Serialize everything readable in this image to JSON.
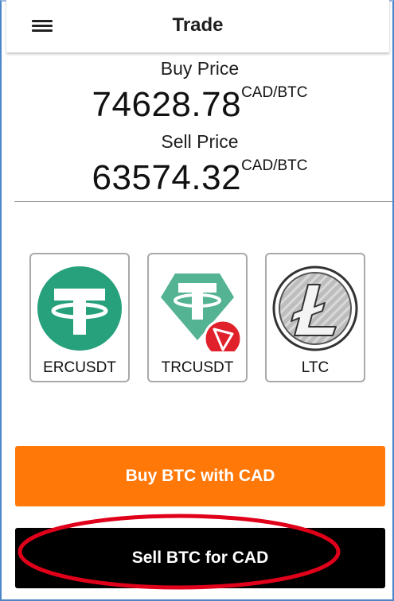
{
  "header": {
    "title": "Trade",
    "menu_icon": "hamburger-menu-icon"
  },
  "prices": {
    "buy_label": "Buy Price",
    "buy_value": "74628.78",
    "buy_unit": "CAD/BTC",
    "sell_label": "Sell Price",
    "sell_value": "63574.32",
    "sell_unit": "CAD/BTC"
  },
  "coins": [
    {
      "label": "ERCUSDT",
      "icon": "tether-icon"
    },
    {
      "label": "TRCUSDT",
      "icon": "tether-tron-icon"
    },
    {
      "label": "LTC",
      "icon": "litecoin-icon"
    }
  ],
  "actions": {
    "buy_label": "Buy BTC with CAD",
    "sell_label": "Sell BTC for CAD"
  },
  "colors": {
    "buy_button": "#ff7808",
    "sell_button": "#000000",
    "tether_green": "#26a17b",
    "tron_red": "#e0202b",
    "highlight": "#e0001a"
  }
}
